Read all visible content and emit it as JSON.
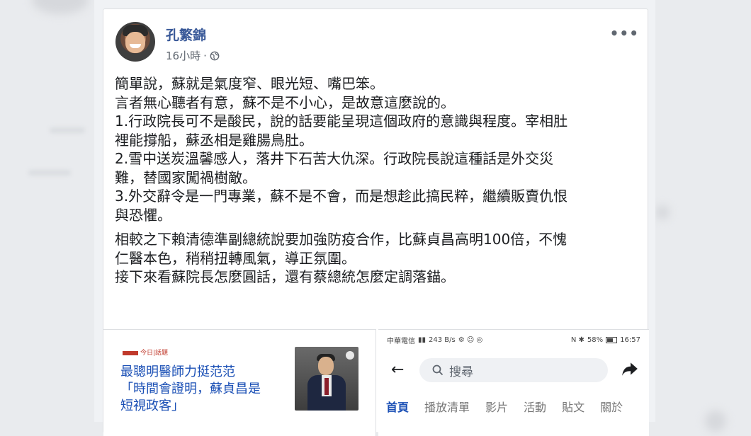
{
  "post": {
    "author": "孔繁錦",
    "time": "16小時",
    "separator": "·",
    "more": "•••",
    "lines_1": [
      "簡單說，蘇就是氣度窄、眼光短、嘴巴笨。",
      "言者無心聽者有意，蘇不是不小心，是故意這麼說的。",
      "1.行政院長可不是酸民，說的話要能呈現這個政府的意識與程度。宰相肚",
      "裡能撐船，蘇丞相是雞腸鳥肚。",
      "2.雪中送炭溫馨感人，落井下石苦大仇深。行政院長說這種話是外交災",
      "難，替國家闖禍樹敵。",
      "3.外交辭令是一門專業，蘇不是不會，而是想趁此搞民粹，繼續販賣仇恨",
      "與恐懼。"
    ],
    "lines_2": [
      "相較之下賴清德準副總統說要加強防疫合作，比蘇貞昌高明100倍，不愧",
      "仁醫本色，稍稍扭轉風氣，導正氛圍。",
      "接下來看蘇院長怎麼圓話，還有蔡總統怎麼定調落錨。"
    ]
  },
  "link_card": {
    "brand": "今日|話題",
    "title_lines": [
      "最聰明醫師力挺范范",
      "「時間會證明，蘇貞昌是",
      "短視政客」"
    ]
  },
  "phone": {
    "status_left": "中華電信",
    "status_speed": "243 B/s",
    "status_right": "58%",
    "status_time": "16:57",
    "back": "←",
    "search_placeholder": "搜尋",
    "tabs": [
      "首頁",
      "播放清單",
      "影片",
      "活動",
      "貼文",
      "關於"
    ]
  },
  "colors": {
    "name_blue": "#385898",
    "link_blue": "#1a4fb5",
    "brand_red": "#c0392b"
  }
}
